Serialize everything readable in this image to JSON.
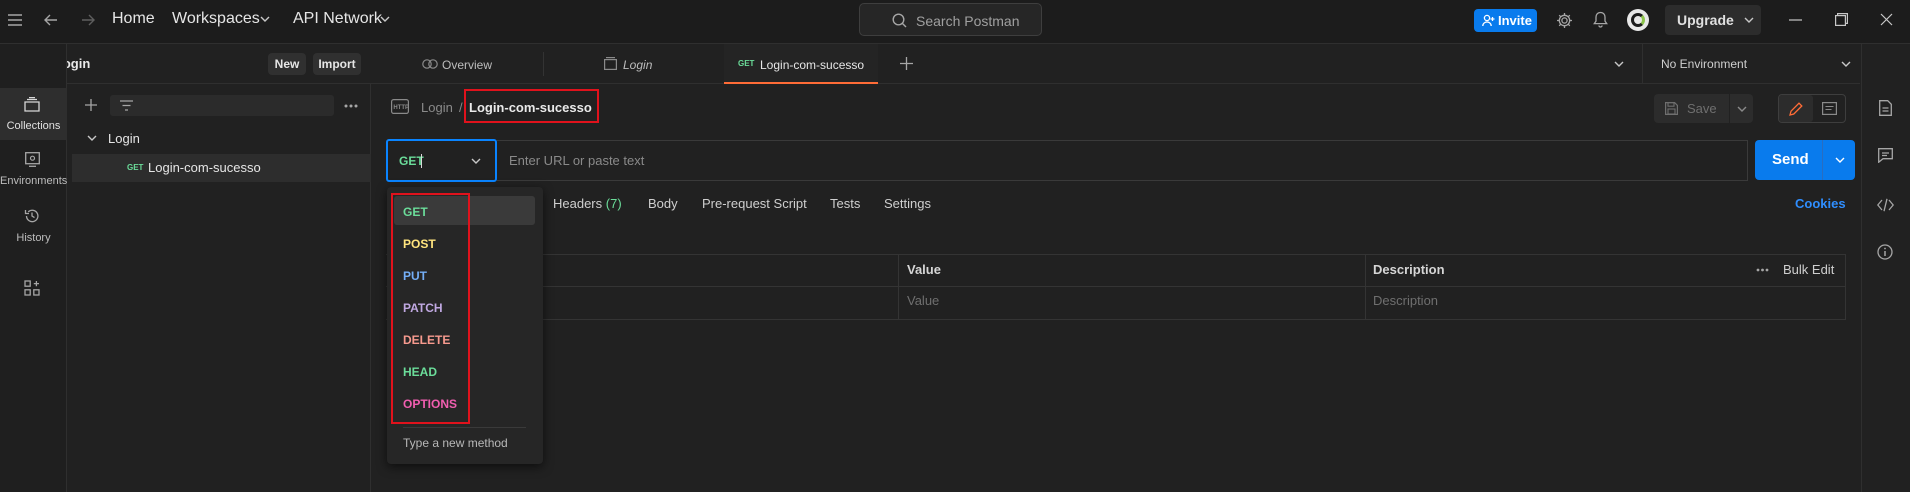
{
  "topbar": {
    "home": "Home",
    "workspaces": "Workspaces",
    "api_network": "API Network",
    "search_placeholder": "Search Postman",
    "invite": "Invite",
    "upgrade": "Upgrade"
  },
  "workspace": {
    "name": "API_Login",
    "new_button": "New",
    "import_button": "Import"
  },
  "rail": [
    {
      "label": "Collections"
    },
    {
      "label": "Environments"
    },
    {
      "label": "History"
    }
  ],
  "sidebar": {
    "collection": "Login",
    "request_method": "GET",
    "request_name": "Login-com-sucesso"
  },
  "tabs": [
    {
      "label": "Overview"
    },
    {
      "label": "Login"
    },
    {
      "method": "GET",
      "label": "Login-com-sucesso"
    }
  ],
  "environment": "No Environment",
  "request": {
    "breadcrumb_parent": "Login",
    "breadcrumb_sep": "/",
    "name": "Login-com-sucesso",
    "save": "Save",
    "method": "GET",
    "url_placeholder": "Enter URL or paste text",
    "send": "Send",
    "subtabs": {
      "headers": "Headers",
      "headers_count": "(7)",
      "body": "Body",
      "prerequest": "Pre-request Script",
      "tests": "Tests",
      "settings": "Settings"
    },
    "cookies": "Cookies"
  },
  "params_table": {
    "headers": {
      "value": "Value",
      "description": "Description",
      "bulk_edit": "Bulk Edit"
    },
    "placeholders": {
      "value": "Value",
      "description": "Description"
    }
  },
  "method_dropdown": {
    "items": [
      {
        "label": "GET",
        "color": "#6bdd9a"
      },
      {
        "label": "POST",
        "color": "#ffe47e"
      },
      {
        "label": "PUT",
        "color": "#74aef6"
      },
      {
        "label": "PATCH",
        "color": "#c0a8e1"
      },
      {
        "label": "DELETE",
        "color": "#f79a8e"
      },
      {
        "label": "HEAD",
        "color": "#6bdd9a"
      },
      {
        "label": "OPTIONS",
        "color": "#f15eb0"
      }
    ],
    "new_method": "Type a new method"
  },
  "colors": {
    "accent": "#097bed",
    "highlight": "#e0121c",
    "active_tab": "#ff6c37"
  }
}
